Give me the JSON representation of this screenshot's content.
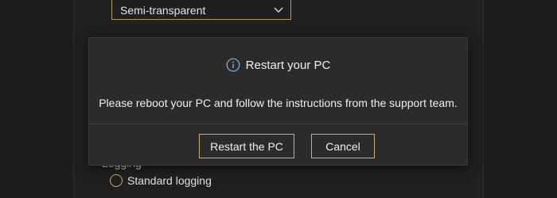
{
  "background_settings": {
    "transparency_dropdown": {
      "selected": "Semi-transparent",
      "icon": "chevron-down-icon"
    },
    "logging_heading": "Logging",
    "logging_option": "Standard logging"
  },
  "dialog": {
    "icon": "info-icon",
    "title": "Restart your PC",
    "message": "Please reboot your PC and follow the instructions from the support team.",
    "primary_button": "Restart the PC",
    "cancel_button": "Cancel"
  },
  "colors": {
    "accent": "#c9b071",
    "dialog_background": "#2b2b2b",
    "page_background": "#202020"
  }
}
